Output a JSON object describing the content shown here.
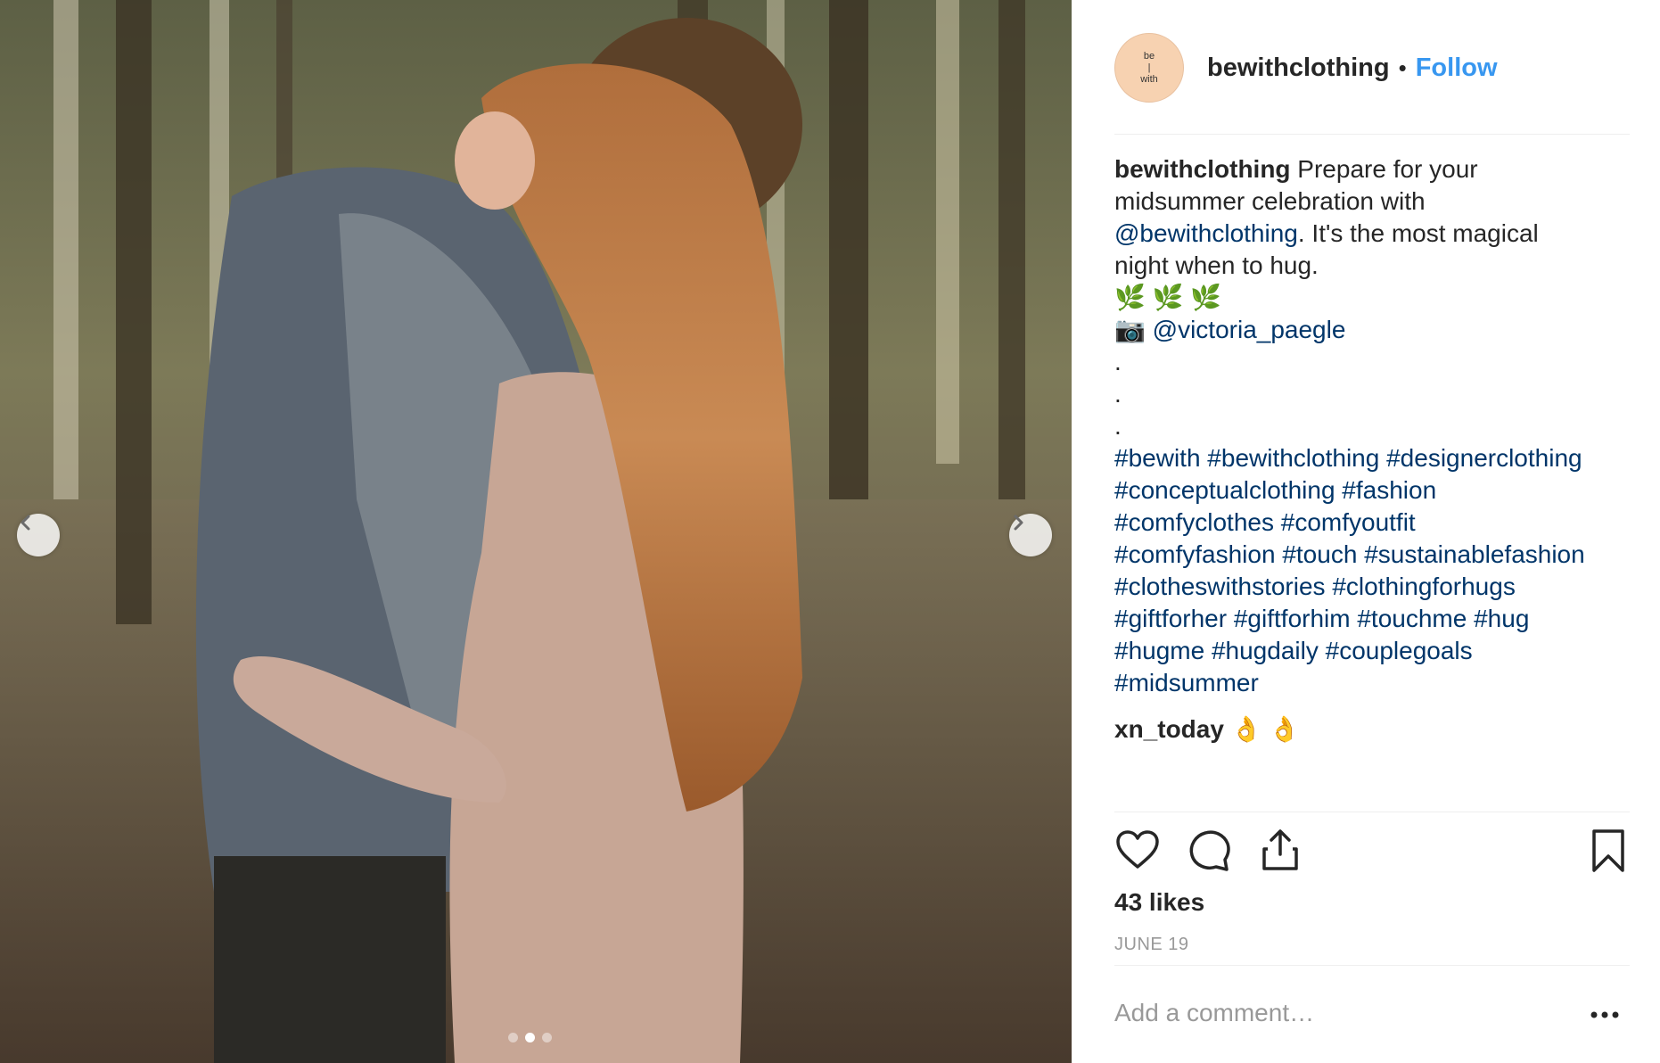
{
  "post": {
    "username": "bewithclothing",
    "separator": "•",
    "follow_label": "Follow",
    "avatar_text": [
      "be",
      "|",
      "with"
    ],
    "caption": {
      "username": "bewithclothing",
      "text_1": " Prepare for your midsummer celebration with ",
      "mention_1": "@bewithclothing",
      "text_2": ". It's the most magical night when to hug.",
      "emoji_line": "🌿 🌿 🌿",
      "camera": "📷",
      "mention_2": "@victoria_paegle",
      "dot": ".",
      "hashtags": [
        "#bewith",
        "#bewithclothing",
        "#designerclothing",
        "#conceptualclothing",
        "#fashion",
        "#comfyclothes",
        "#comfyoutfit",
        "#comfyfashion",
        "#touch",
        "#sustainablefashion",
        "#clotheswithstories",
        "#clothingforhugs",
        "#giftforher",
        "#giftforhim",
        "#touchme",
        "#hug",
        "#hugme",
        "#hugdaily",
        "#couplegoals",
        "#midsummer"
      ]
    },
    "comment": {
      "username": "xn_today",
      "text": " 👌 👌"
    },
    "likes": "43 likes",
    "date": "JUNE 19",
    "add_comment_placeholder": "Add a comment…",
    "carousel": {
      "total": 3,
      "current": 2
    }
  },
  "icons": {
    "like": "heart-icon",
    "comment": "comment-bubble-icon",
    "share": "share-icon",
    "save": "bookmark-icon",
    "more": "more-options-icon",
    "prev": "chevron-left-icon",
    "next": "chevron-right-icon"
  },
  "colors": {
    "follow": "#3897f0",
    "link": "#003569",
    "muted": "#999999",
    "text": "#262626"
  }
}
